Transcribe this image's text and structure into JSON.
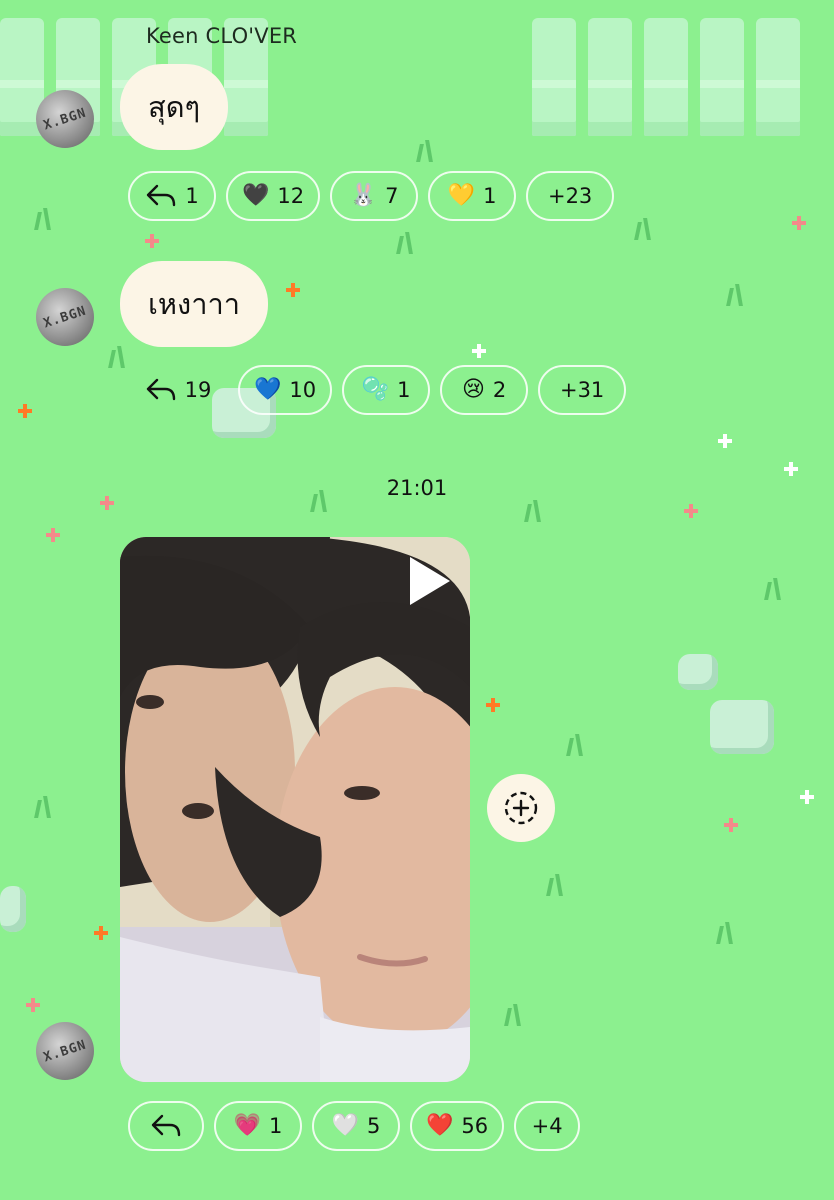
{
  "chat": {
    "sender_name": "Keen CLO'VER",
    "timestamp": "21:01",
    "avatar_text": "X.BGN",
    "messages": [
      {
        "text": "สุดๆ",
        "reactions": [
          {
            "icon": "reply-icon",
            "count": "1"
          },
          {
            "emoji": "🖤",
            "count": "12"
          },
          {
            "emoji": "🐰",
            "count": "7"
          },
          {
            "emoji": "💛",
            "count": "1"
          },
          {
            "count": "+23"
          }
        ]
      },
      {
        "text": "เหงาาา",
        "reactions": [
          {
            "icon": "reply-icon",
            "count": "19"
          },
          {
            "emoji": "💙",
            "count": "10"
          },
          {
            "emoji": "🫧",
            "count": "1"
          },
          {
            "emoji": "😢",
            "count": "2"
          },
          {
            "count": "+31"
          }
        ]
      },
      {
        "type": "video",
        "reactions": [
          {
            "icon": "reply-icon",
            "count": ""
          },
          {
            "emoji": "💗",
            "count": "1"
          },
          {
            "emoji": "🤍",
            "count": "5"
          },
          {
            "emoji": "❤️",
            "count": "56"
          },
          {
            "count": "+4"
          }
        ]
      }
    ]
  },
  "colors": {
    "background": "#8cf08f",
    "bubble": "#fcf5e6",
    "chip_border": "#ffffff"
  }
}
